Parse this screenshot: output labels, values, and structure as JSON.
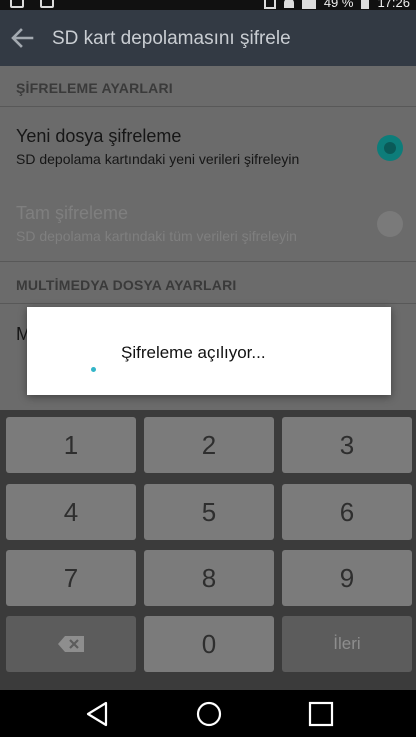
{
  "status_bar": {
    "battery": "49 %",
    "time": "17:26"
  },
  "app_bar": {
    "title": "SD kart depolamasını şifrele",
    "back_icon": "arrow-back-icon"
  },
  "sections": {
    "encryption_header": "ŞİFRELEME AYARLARI",
    "multimedia_header": "MULTİMEDYA DOSYA AYARLARI"
  },
  "options": [
    {
      "title": "Yeni dosya şifreleme",
      "subtitle": "SD depolama kartındaki yeni verileri şifreleyin",
      "selected": true,
      "enabled": true
    },
    {
      "title": "Tam şifreleme",
      "subtitle": "SD depolama kartındaki tüm verileri şifreleyin",
      "selected": false,
      "enabled": false
    }
  ],
  "multimedia_partial": "M",
  "dialog": {
    "message": "Şifreleme açılıyor..."
  },
  "keypad": {
    "keys": [
      "1",
      "2",
      "3",
      "4",
      "5",
      "6",
      "7",
      "8",
      "9"
    ],
    "zero": "0",
    "next": "İleri",
    "backspace_icon": "backspace-icon"
  },
  "colors": {
    "accent": "#0d7d7a",
    "spinner": "#33b5c8",
    "app_bar": "#333a44"
  }
}
